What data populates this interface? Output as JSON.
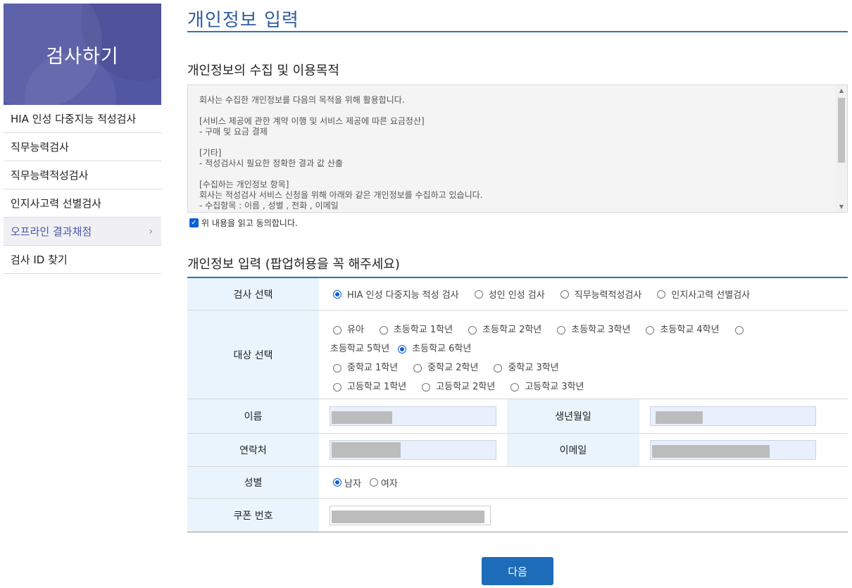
{
  "sidebar": {
    "banner_title": "검사하기",
    "items": [
      {
        "label": "HIA 인성 다중지능 적성검사"
      },
      {
        "label": "직무능력검사"
      },
      {
        "label": "직무능력적성검사"
      },
      {
        "label": "인지사고력 선별검사"
      },
      {
        "label": "오프라인 결과채점",
        "active": true
      },
      {
        "label": "검사 ID 찾기"
      }
    ]
  },
  "main": {
    "page_title": "개인정보 입력",
    "section_purpose_title": "개인정보의 수집 및 이용목적",
    "terms_text": "회사는 수집한 개인정보를 다음의 목적을 위해 활용합니다.\n\n[서비스 제공에 관한 계약 이행 및 서비스 제공에 따른 요금정산]\n- 구매 및 요금 결제\n\n[기타]\n- 적성검사시 필요한 정확한 결과 값 산출\n\n[수집하는 개인정보 항목]\n회사는 적성검사 서비스 신청을 위해 아래와 같은 개인정보를 수집하고 있습니다.\n- 수집항목 : 이름 , 성별 , 전화 , 이메일",
    "agree_label": "위 내용을 읽고 동의합니다.",
    "section_input_title": "개인정보 입력 (팝업허용을 꼭 해주세요)",
    "form": {
      "test_select_label": "검사 선택",
      "test_options": [
        {
          "label": "HIA 인성 다중지능 적성 검사",
          "checked": true
        },
        {
          "label": "성인 인성 검사",
          "checked": false
        },
        {
          "label": "직무능력적성검사",
          "checked": false
        },
        {
          "label": "인지사고력 선별검사",
          "checked": false
        }
      ],
      "target_select_label": "대상 선택",
      "target_options": {
        "preschool": "유아",
        "elem1": "초등학교 1학년",
        "elem2": "초등학교 2학년",
        "elem3": "초등학교 3학년",
        "elem4": "초등학교 4학년",
        "elem5": "초등학교 5학년",
        "elem6": "초등학교 6학년",
        "mid1": "중학교 1학년",
        "mid2": "중학교 2학년",
        "mid3": "중학교 3학년",
        "high1": "고등학교 1학년",
        "high2": "고등학교 2학년",
        "high3": "고등학교 3학년",
        "selected": "초등학교 6학년"
      },
      "name_label": "이름",
      "birth_label": "생년월일",
      "contact_label": "연락처",
      "email_label": "이메일",
      "gender_label": "성별",
      "gender_options": {
        "male": "남자",
        "female": "여자",
        "selected": "남자"
      },
      "coupon_label": "쿠폰 번호"
    },
    "next_button": "다음"
  },
  "colors": {
    "accent": "#2e73b8",
    "banner": "#5257a3",
    "label_bg": "#eaf4fc",
    "button": "#1d6cb9"
  }
}
